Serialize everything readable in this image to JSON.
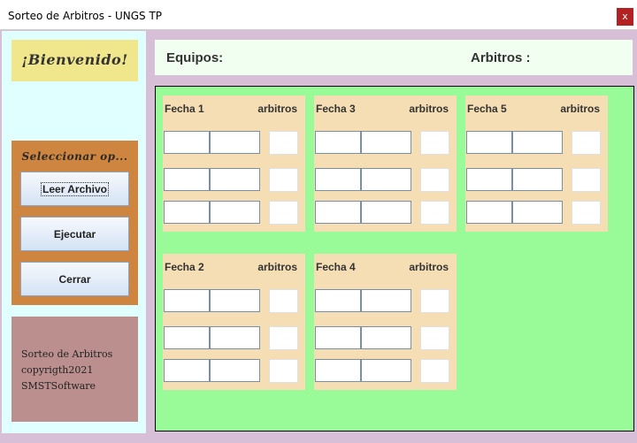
{
  "window": {
    "title": "Sorteo de Arbitros - UNGS TP",
    "close_label": "x"
  },
  "sidebar": {
    "welcome": "¡Bienvenido!",
    "options_title": "Seleccionar op...",
    "buttons": {
      "leer": "Leer Archivo",
      "ejecutar": "Ejecutar",
      "cerrar": "Cerrar"
    },
    "info": {
      "line1": "Sorteo de Arbitros",
      "line2": "copyrigth2021",
      "line3": "SMSTSoftware"
    }
  },
  "header": {
    "equipos_label": "Equipos:",
    "arbitros_label": "Arbitros :"
  },
  "fechas": [
    {
      "name": "Fecha 1",
      "arbitros_label": "arbitros"
    },
    {
      "name": "Fecha 3",
      "arbitros_label": "arbitros"
    },
    {
      "name": "Fecha 5",
      "arbitros_label": "arbitros"
    },
    {
      "name": "Fecha 2",
      "arbitros_label": "arbitros"
    },
    {
      "name": "Fecha 4",
      "arbitros_label": "arbitros"
    }
  ],
  "colors": {
    "window_bg": "#d8bfd8",
    "sidebar_bg": "#e0ffff",
    "welcome_bg": "#f0e68c",
    "options_bg": "#cd853f",
    "info_bg": "#bc8f8f",
    "header_bg": "#f0fff0",
    "fechas_area_bg": "#98fb98",
    "fecha_panel_bg": "#f5deb3",
    "close_button_bg": "#b22222"
  }
}
